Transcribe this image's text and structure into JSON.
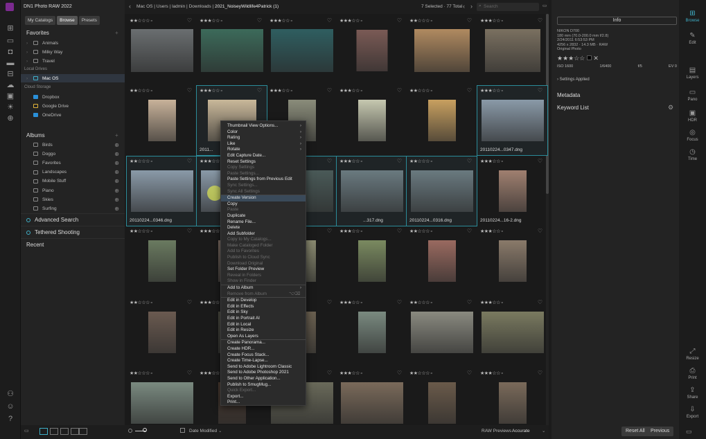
{
  "app": {
    "title": "DN1 Photo RAW 2022",
    "tabs": [
      "My Catalogs",
      "Browse",
      "Presets"
    ]
  },
  "left": {
    "favorites_title": "Favorites",
    "favorites": [
      "Animals",
      "Milky Way",
      "Travel"
    ],
    "local_drives_title": "Local Drives",
    "local_drive": "Mac OS",
    "cloud_title": "Cloud Storage",
    "cloud": [
      "Dropbox",
      "Google Drive",
      "OneDrive"
    ],
    "albums_title": "Albums",
    "albums": [
      "Birds",
      "Doggo",
      "Favorites",
      "Landscapes",
      "Mobile Stuff",
      "Piano",
      "Skies",
      "Surfing"
    ],
    "advanced_search": "Advanced Search",
    "tethered": "Tethered Shooting",
    "recent": "Recent"
  },
  "topbar": {
    "path": [
      "Mac OS",
      "Users",
      "ladmin",
      "Downloads",
      "2021_NoiseyWildlife4Patrick (1)"
    ],
    "count": "7 Selected · 77 Total",
    "search_placeholder": "Search"
  },
  "grid": {
    "filenames": [
      "20110224...0347.dng",
      "20110224...0346.dng",
      "2011...",
      "...317.dng",
      "20110224...0316.dng",
      "20110224...16-2.dng"
    ]
  },
  "menu": {
    "items": [
      {
        "t": "Thumbnail View Options...",
        "sub": "›"
      },
      {
        "t": "Color",
        "sub": "›"
      },
      {
        "t": "Rating",
        "sub": "›"
      },
      {
        "t": "Like",
        "sub": "›"
      },
      {
        "t": "Rotate",
        "sub": "›"
      },
      {
        "t": "Edit Capture Date..."
      },
      {
        "t": "Reset Settings"
      },
      {
        "t": "Copy Settings",
        "dis": true
      },
      {
        "t": "Paste Settings...",
        "dis": true
      },
      {
        "t": "Paste Settings from Previous Edit"
      },
      {
        "t": "Sync Settings...",
        "dis": true
      },
      {
        "t": "Sync All Settings",
        "dis": true
      },
      {
        "sep": true
      },
      {
        "t": "Create Version"
      },
      {
        "t": "Copy"
      },
      {
        "t": "Paste",
        "dis": true
      },
      {
        "t": "Duplicate"
      },
      {
        "t": "Rename File..."
      },
      {
        "t": "Delete"
      },
      {
        "t": "Add Subfolder"
      },
      {
        "t": "Copy to My Catalogs...",
        "dis": true
      },
      {
        "t": "Make Cataloged Folder",
        "dis": true
      },
      {
        "t": "Add to Favorites",
        "dis": true
      },
      {
        "t": "Publish to Cloud Sync",
        "dis": true
      },
      {
        "t": "Download Original",
        "dis": true
      },
      {
        "t": "Set Folder Preview"
      },
      {
        "t": "Reveal in Folders",
        "dis": true
      },
      {
        "t": "Show in Finder",
        "dis": true
      },
      {
        "sep": true
      },
      {
        "t": "Add to Album",
        "sub": "›"
      },
      {
        "t": "Remove from Album",
        "dis": true,
        "sc": "⌥⌫"
      },
      {
        "sep": true
      },
      {
        "t": "Edit in Develop"
      },
      {
        "t": "Edit in Effects"
      },
      {
        "t": "Edit in Sky"
      },
      {
        "t": "Edit in Portrait AI"
      },
      {
        "t": "Edit in Local"
      },
      {
        "t": "Edit in Resize"
      },
      {
        "t": "Open As Layers"
      },
      {
        "sep": true
      },
      {
        "t": "Create Panorama..."
      },
      {
        "t": "Create HDR..."
      },
      {
        "t": "Create Focus Stack..."
      },
      {
        "t": "Create Time-Lapse..."
      },
      {
        "t": "Send to Adobe Lightroom Classic"
      },
      {
        "t": "Send to Adobe Photoshop 2021"
      },
      {
        "t": "Send to Other Application..."
      },
      {
        "t": "Publish to SmugMug..."
      },
      {
        "t": "Quick Export...",
        "dis": true
      },
      {
        "t": "Export..."
      },
      {
        "t": "Print..."
      }
    ]
  },
  "right": {
    "info_tab": "Info",
    "camera": "NIKON D700",
    "lens": "180 mm (70.0-200.0 mm f/2.8)",
    "date": "2/24/2011 6:53:53 PM",
    "size": "4256 x 2832 · 14.3 MB · RAW",
    "type": "Original Photo",
    "iso": "ISO 1600",
    "shutter": "1/6400",
    "aperture": "f/5",
    "ev": "EV 0",
    "settings_applied": "Settings Applied",
    "metadata": "Metadata",
    "keyword_list": "Keyword List"
  },
  "rightbar": [
    "Browse",
    "Edit",
    "Layers",
    "Pano",
    "HDR",
    "Focus",
    "Time",
    "Resize",
    "Print",
    "Share",
    "Export"
  ],
  "bottom": {
    "sort": "Date Modified",
    "raw_label": "RAW Previews",
    "raw_value": "Accurate",
    "reset": "Reset All",
    "previous": "Previous"
  }
}
